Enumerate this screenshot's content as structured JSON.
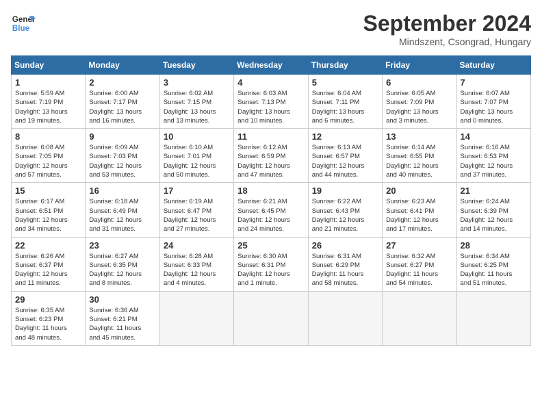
{
  "header": {
    "logo_line1": "General",
    "logo_line2": "Blue",
    "month": "September 2024",
    "location": "Mindszent, Csongrad, Hungary"
  },
  "days_of_week": [
    "Sunday",
    "Monday",
    "Tuesday",
    "Wednesday",
    "Thursday",
    "Friday",
    "Saturday"
  ],
  "weeks": [
    [
      {
        "day": "1",
        "lines": [
          "Sunrise: 5:59 AM",
          "Sunset: 7:19 PM",
          "Daylight: 13 hours",
          "and 19 minutes."
        ]
      },
      {
        "day": "2",
        "lines": [
          "Sunrise: 6:00 AM",
          "Sunset: 7:17 PM",
          "Daylight: 13 hours",
          "and 16 minutes."
        ]
      },
      {
        "day": "3",
        "lines": [
          "Sunrise: 6:02 AM",
          "Sunset: 7:15 PM",
          "Daylight: 13 hours",
          "and 13 minutes."
        ]
      },
      {
        "day": "4",
        "lines": [
          "Sunrise: 6:03 AM",
          "Sunset: 7:13 PM",
          "Daylight: 13 hours",
          "and 10 minutes."
        ]
      },
      {
        "day": "5",
        "lines": [
          "Sunrise: 6:04 AM",
          "Sunset: 7:11 PM",
          "Daylight: 13 hours",
          "and 6 minutes."
        ]
      },
      {
        "day": "6",
        "lines": [
          "Sunrise: 6:05 AM",
          "Sunset: 7:09 PM",
          "Daylight: 13 hours",
          "and 3 minutes."
        ]
      },
      {
        "day": "7",
        "lines": [
          "Sunrise: 6:07 AM",
          "Sunset: 7:07 PM",
          "Daylight: 13 hours",
          "and 0 minutes."
        ]
      }
    ],
    [
      {
        "day": "8",
        "lines": [
          "Sunrise: 6:08 AM",
          "Sunset: 7:05 PM",
          "Daylight: 12 hours",
          "and 57 minutes."
        ]
      },
      {
        "day": "9",
        "lines": [
          "Sunrise: 6:09 AM",
          "Sunset: 7:03 PM",
          "Daylight: 12 hours",
          "and 53 minutes."
        ]
      },
      {
        "day": "10",
        "lines": [
          "Sunrise: 6:10 AM",
          "Sunset: 7:01 PM",
          "Daylight: 12 hours",
          "and 50 minutes."
        ]
      },
      {
        "day": "11",
        "lines": [
          "Sunrise: 6:12 AM",
          "Sunset: 6:59 PM",
          "Daylight: 12 hours",
          "and 47 minutes."
        ]
      },
      {
        "day": "12",
        "lines": [
          "Sunrise: 6:13 AM",
          "Sunset: 6:57 PM",
          "Daylight: 12 hours",
          "and 44 minutes."
        ]
      },
      {
        "day": "13",
        "lines": [
          "Sunrise: 6:14 AM",
          "Sunset: 6:55 PM",
          "Daylight: 12 hours",
          "and 40 minutes."
        ]
      },
      {
        "day": "14",
        "lines": [
          "Sunrise: 6:16 AM",
          "Sunset: 6:53 PM",
          "Daylight: 12 hours",
          "and 37 minutes."
        ]
      }
    ],
    [
      {
        "day": "15",
        "lines": [
          "Sunrise: 6:17 AM",
          "Sunset: 6:51 PM",
          "Daylight: 12 hours",
          "and 34 minutes."
        ]
      },
      {
        "day": "16",
        "lines": [
          "Sunrise: 6:18 AM",
          "Sunset: 6:49 PM",
          "Daylight: 12 hours",
          "and 31 minutes."
        ]
      },
      {
        "day": "17",
        "lines": [
          "Sunrise: 6:19 AM",
          "Sunset: 6:47 PM",
          "Daylight: 12 hours",
          "and 27 minutes."
        ]
      },
      {
        "day": "18",
        "lines": [
          "Sunrise: 6:21 AM",
          "Sunset: 6:45 PM",
          "Daylight: 12 hours",
          "and 24 minutes."
        ]
      },
      {
        "day": "19",
        "lines": [
          "Sunrise: 6:22 AM",
          "Sunset: 6:43 PM",
          "Daylight: 12 hours",
          "and 21 minutes."
        ]
      },
      {
        "day": "20",
        "lines": [
          "Sunrise: 6:23 AM",
          "Sunset: 6:41 PM",
          "Daylight: 12 hours",
          "and 17 minutes."
        ]
      },
      {
        "day": "21",
        "lines": [
          "Sunrise: 6:24 AM",
          "Sunset: 6:39 PM",
          "Daylight: 12 hours",
          "and 14 minutes."
        ]
      }
    ],
    [
      {
        "day": "22",
        "lines": [
          "Sunrise: 6:26 AM",
          "Sunset: 6:37 PM",
          "Daylight: 12 hours",
          "and 11 minutes."
        ]
      },
      {
        "day": "23",
        "lines": [
          "Sunrise: 6:27 AM",
          "Sunset: 6:35 PM",
          "Daylight: 12 hours",
          "and 8 minutes."
        ]
      },
      {
        "day": "24",
        "lines": [
          "Sunrise: 6:28 AM",
          "Sunset: 6:33 PM",
          "Daylight: 12 hours",
          "and 4 minutes."
        ]
      },
      {
        "day": "25",
        "lines": [
          "Sunrise: 6:30 AM",
          "Sunset: 6:31 PM",
          "Daylight: 12 hours",
          "and 1 minute."
        ]
      },
      {
        "day": "26",
        "lines": [
          "Sunrise: 6:31 AM",
          "Sunset: 6:29 PM",
          "Daylight: 11 hours",
          "and 58 minutes."
        ]
      },
      {
        "day": "27",
        "lines": [
          "Sunrise: 6:32 AM",
          "Sunset: 6:27 PM",
          "Daylight: 11 hours",
          "and 54 minutes."
        ]
      },
      {
        "day": "28",
        "lines": [
          "Sunrise: 6:34 AM",
          "Sunset: 6:25 PM",
          "Daylight: 11 hours",
          "and 51 minutes."
        ]
      }
    ],
    [
      {
        "day": "29",
        "lines": [
          "Sunrise: 6:35 AM",
          "Sunset: 6:23 PM",
          "Daylight: 11 hours",
          "and 48 minutes."
        ]
      },
      {
        "day": "30",
        "lines": [
          "Sunrise: 6:36 AM",
          "Sunset: 6:21 PM",
          "Daylight: 11 hours",
          "and 45 minutes."
        ]
      },
      {
        "day": "",
        "lines": []
      },
      {
        "day": "",
        "lines": []
      },
      {
        "day": "",
        "lines": []
      },
      {
        "day": "",
        "lines": []
      },
      {
        "day": "",
        "lines": []
      }
    ]
  ]
}
